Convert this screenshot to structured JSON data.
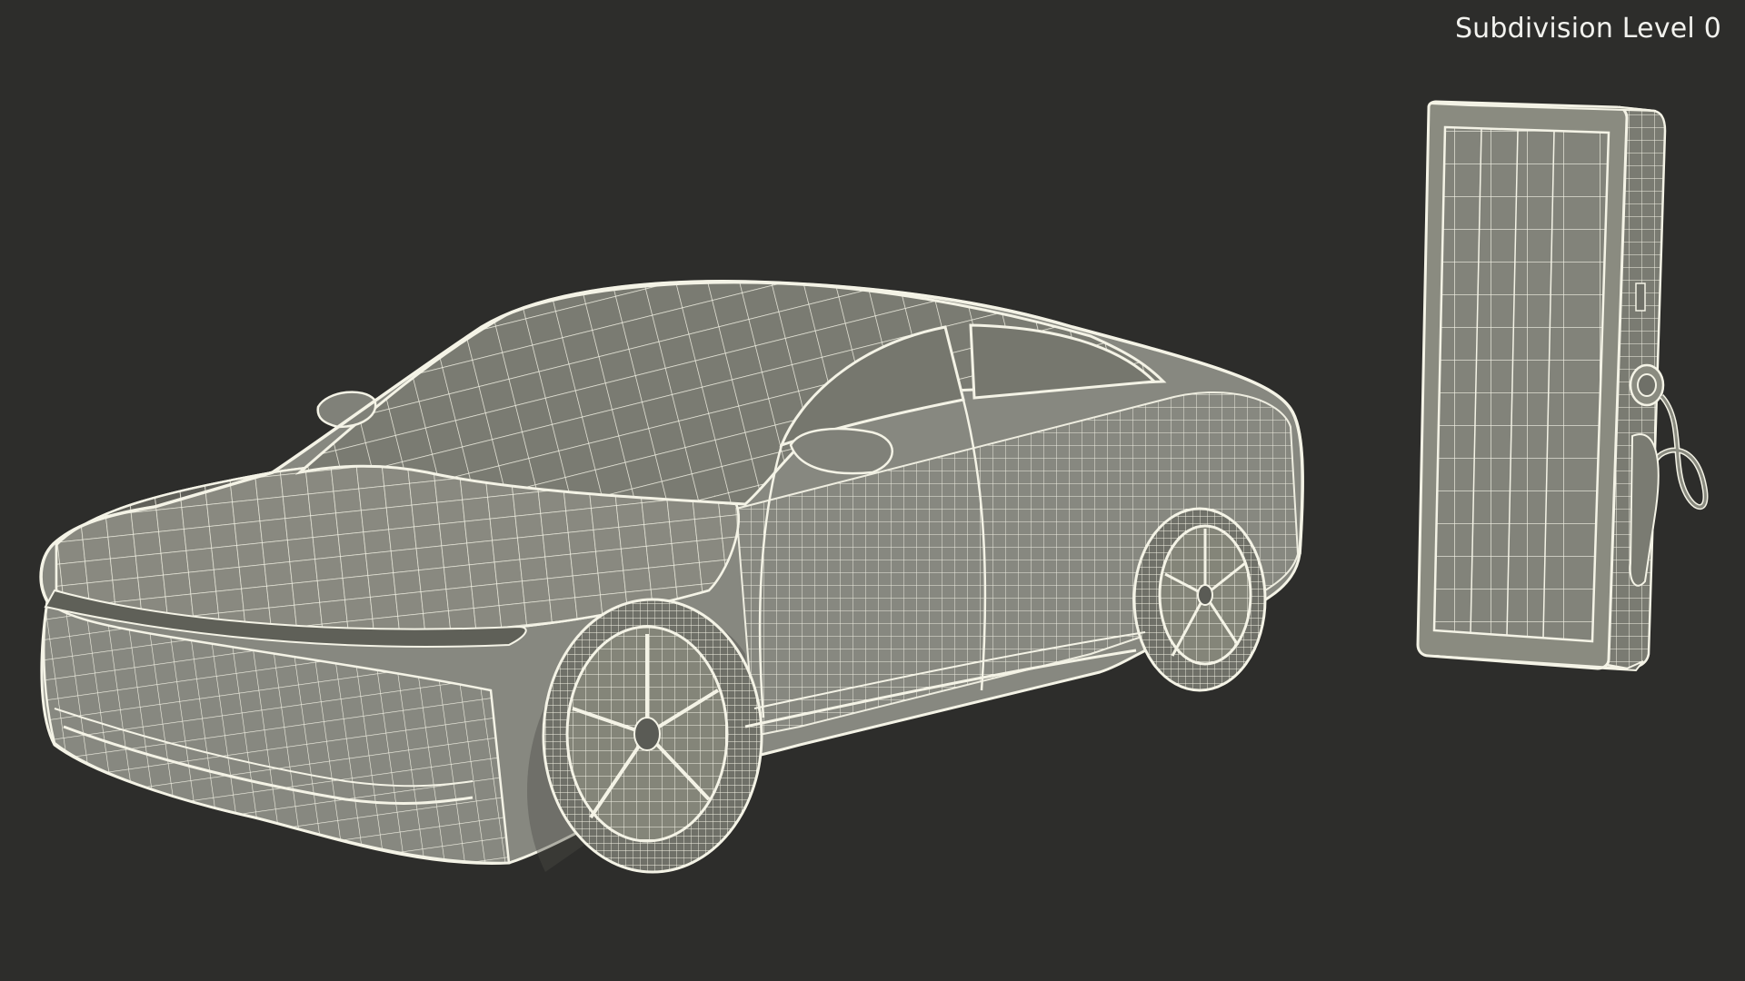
{
  "viewport": {
    "overlay_label": "Subdivision Level 0"
  },
  "colors": {
    "background": "#2d2d2b",
    "surface": "#8a8b80",
    "surface_dark": "#6f7068",
    "wire": "#f4f3e6",
    "label": "#f2f2ee"
  },
  "objects": [
    {
      "name": "electric-sedan",
      "display": "wireframe"
    },
    {
      "name": "ev-charging-station",
      "display": "wireframe"
    }
  ]
}
